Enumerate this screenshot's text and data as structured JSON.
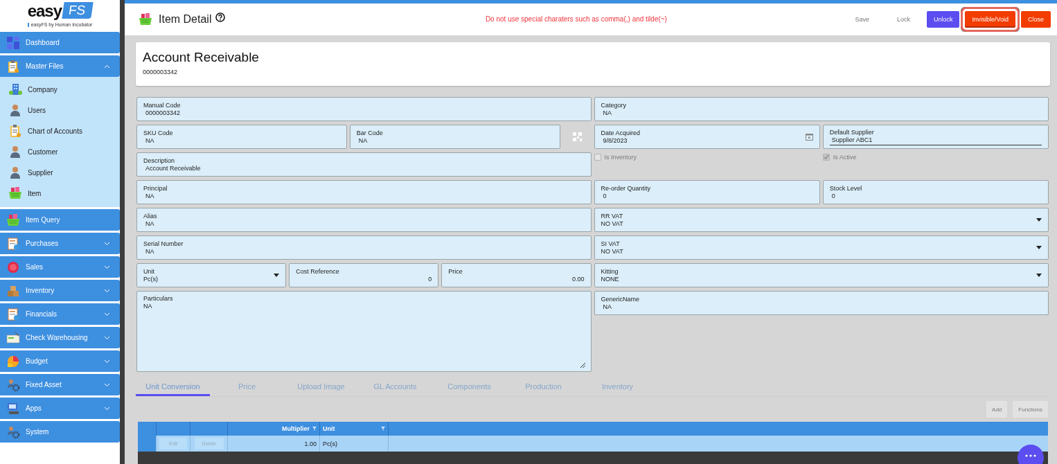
{
  "logo": {
    "wordmark": "easy",
    "badge": "FS",
    "tagline": "easyFS by Human Incubator"
  },
  "sidebar": {
    "items": [
      {
        "label": "Dashboard"
      },
      {
        "label": "Master Files",
        "expanded": true,
        "children": [
          {
            "label": "Company"
          },
          {
            "label": "Users"
          },
          {
            "label": "Chart of Accounts"
          },
          {
            "label": "Customer"
          },
          {
            "label": "Supplier"
          },
          {
            "label": "Item"
          }
        ]
      },
      {
        "label": "Item Query"
      },
      {
        "label": "Purchases",
        "expanded": false
      },
      {
        "label": "Sales",
        "expanded": false
      },
      {
        "label": "Inventory",
        "expanded": false
      },
      {
        "label": "Financials",
        "expanded": false
      },
      {
        "label": "Check Warehousing",
        "expanded": false
      },
      {
        "label": "Budget",
        "expanded": false
      },
      {
        "label": "Fixed Asset",
        "expanded": false
      },
      {
        "label": "Apps",
        "expanded": false
      },
      {
        "label": "System"
      }
    ]
  },
  "header": {
    "title": "Item Detail",
    "notice": "Do not use special charaters such as comma(,) and tilde(~)",
    "buttons": [
      {
        "label": "Save",
        "kind": "plain",
        "disabled": true,
        "highlighted": false
      },
      {
        "label": "Lock",
        "kind": "plain",
        "disabled": true,
        "highlighted": false
      },
      {
        "label": "Unlock",
        "kind": "primary",
        "disabled": false,
        "highlighted": false
      },
      {
        "label": "Invisible/Void",
        "kind": "danger",
        "disabled": false,
        "highlighted": true
      },
      {
        "label": "Close",
        "kind": "danger",
        "disabled": false,
        "highlighted": false
      }
    ]
  },
  "record": {
    "name": "Account Receivable",
    "code": "0000003342"
  },
  "form": {
    "left": [
      [
        {
          "kind": "text",
          "label": "Manual Code",
          "value": "0000003342"
        }
      ],
      [
        {
          "kind": "text",
          "label": "SKU Code",
          "value": "NA"
        },
        {
          "kind": "text",
          "label": "Bar Code",
          "value": "NA"
        },
        {
          "kind": "barcode"
        }
      ],
      [
        {
          "kind": "text",
          "label": "Description",
          "value": "Account Receivable"
        }
      ],
      [
        {
          "kind": "text",
          "label": "Principal",
          "value": "NA"
        }
      ],
      [
        {
          "kind": "text",
          "label": "Alias",
          "value": "NA"
        }
      ],
      [
        {
          "kind": "text",
          "label": "Serial Number",
          "value": "NA"
        }
      ],
      [
        {
          "kind": "select",
          "label": "Unit",
          "value": "Pc(s)"
        },
        {
          "kind": "number",
          "label": "Cost Reference",
          "value": "0"
        },
        {
          "kind": "number",
          "label": "Price",
          "value": "0.00"
        }
      ],
      [
        {
          "kind": "textarea",
          "label": "Particulars",
          "value": "NA"
        }
      ]
    ],
    "right": [
      [
        {
          "kind": "text",
          "label": "Category",
          "value": "NA"
        }
      ],
      [
        {
          "kind": "date",
          "label": "Date Acquired",
          "value": "9/8/2023"
        },
        {
          "kind": "lookup",
          "label": "Default Supplier",
          "value": "Supplier ABC1"
        }
      ],
      [
        {
          "kind": "checkbox",
          "label": "Is Inventory",
          "checked": false,
          "disabled": true
        },
        {
          "kind": "checkbox",
          "label": "Is Active",
          "checked": true,
          "disabled": true
        }
      ],
      [
        {
          "kind": "text",
          "label": "Re-order Quantity",
          "value": "0"
        },
        {
          "kind": "text",
          "label": "Stock Level",
          "value": "0"
        }
      ],
      [
        {
          "kind": "select",
          "label": "RR VAT",
          "value": "NO VAT"
        }
      ],
      [
        {
          "kind": "select",
          "label": "SI VAT",
          "value": "NO VAT"
        }
      ],
      [
        {
          "kind": "select",
          "label": "Kitting",
          "value": "NONE"
        }
      ],
      [
        {
          "kind": "text",
          "label": "GenericName",
          "value": "NA"
        }
      ]
    ]
  },
  "tabs": [
    {
      "label": "Unit Conversion",
      "selected": true
    },
    {
      "label": "Price",
      "selected": false
    },
    {
      "label": "Upload Image",
      "selected": false
    },
    {
      "label": "GL Accounts",
      "selected": false
    },
    {
      "label": "Components",
      "selected": false
    },
    {
      "label": "Production",
      "selected": false
    },
    {
      "label": "Inventory",
      "selected": false
    }
  ],
  "grid_actions": [
    {
      "label": "Add",
      "disabled": true
    },
    {
      "label": "Functions",
      "disabled": true
    }
  ],
  "table": {
    "columns": [
      {
        "label": "Multiplier",
        "kind": "number"
      },
      {
        "label": "Unit",
        "kind": "text"
      }
    ],
    "rows": [
      {
        "actions": [
          {
            "label": "Edit",
            "disabled": true
          },
          {
            "label": "Delete",
            "disabled": true
          }
        ],
        "cells": [
          "1.00",
          "Pc(s)"
        ]
      }
    ]
  }
}
